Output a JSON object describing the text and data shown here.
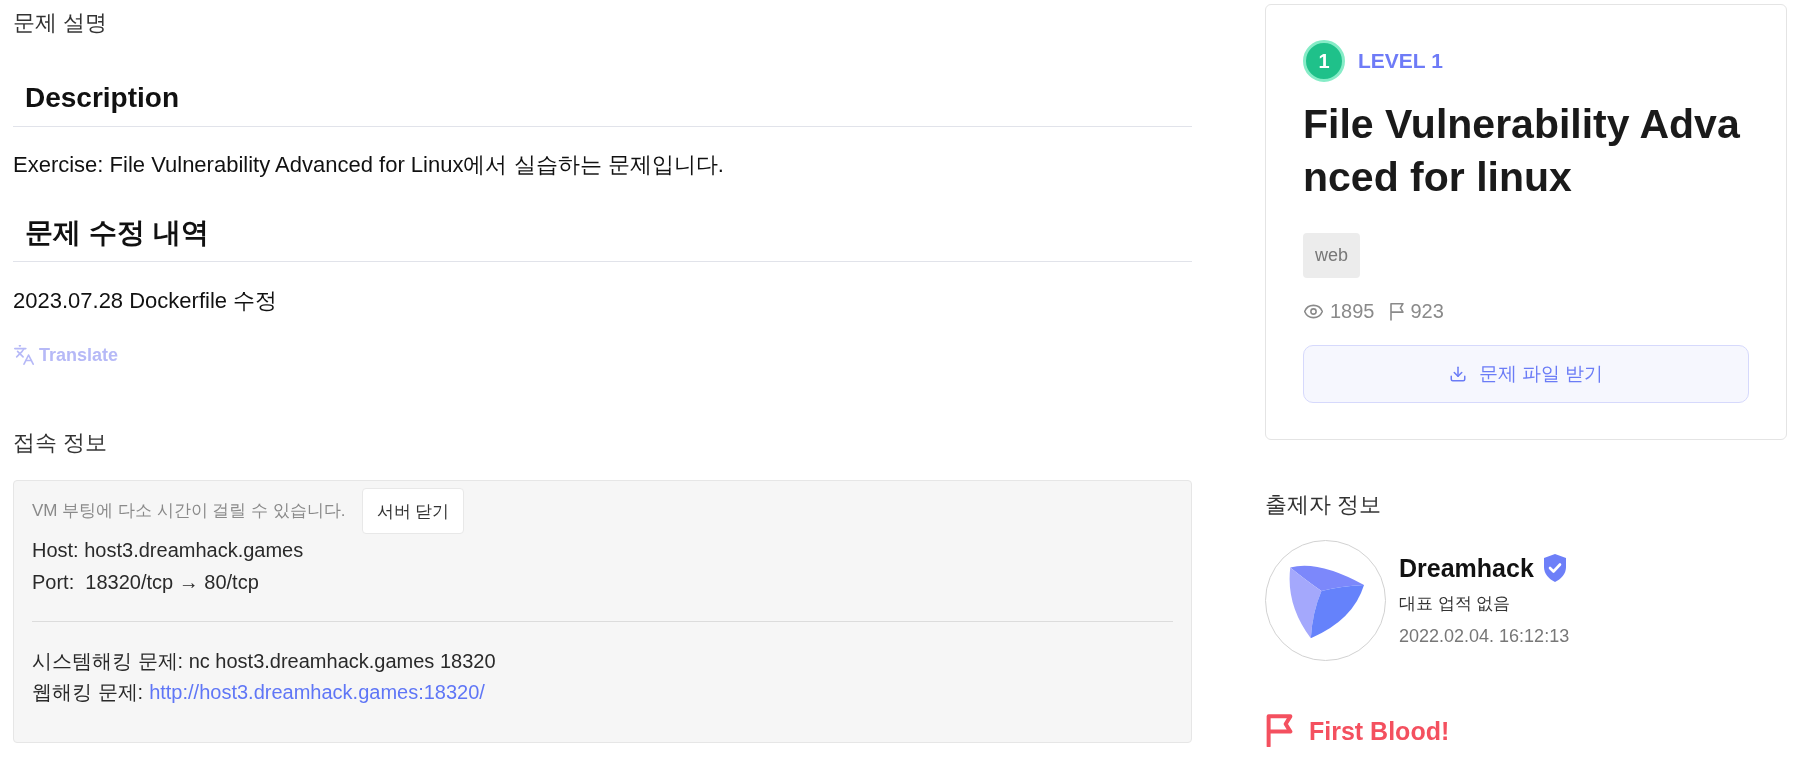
{
  "problem_description": {
    "title": "문제 설명",
    "sections": [
      {
        "heading": "Description",
        "body": "Exercise: File Vulnerability Advanced for Linux에서 실습하는 문제입니다."
      },
      {
        "heading": "문제 수정 내역",
        "body": "2023.07.28 Dockerfile 수정"
      }
    ],
    "translate_link": "Translate"
  },
  "connection_info": {
    "title": "접속 정보",
    "notice": "VM 부팅에 다소 시간이 걸릴 수 있습니다.",
    "close_button": "서버 닫기",
    "details": [
      "Host: host3.dreamhack.games",
      "Port:  18320/tcp → 80/tcp"
    ],
    "commands": [
      {
        "kind": "text",
        "text": "시스템해킹 문제: nc host3.dreamhack.games 18320"
      },
      {
        "kind": "link",
        "label": "웹해킹 문제:",
        "url": "http://host3.dreamhack.games:18320/"
      }
    ]
  },
  "challenge_card": {
    "level_number": "1",
    "level_label": "LEVEL 1",
    "title": "File Vulnerability Advanced for linux",
    "tags": [
      "web"
    ],
    "views": "1895",
    "solves": "923",
    "download_button": "문제 파일 받기"
  },
  "author": {
    "title": "출제자 정보",
    "name": "Dreamhack",
    "verified": true,
    "achievement": "대표 업적 없음",
    "date": "2022.02.04. 16:12:13"
  },
  "first_blood": {
    "title": "First Blood!"
  }
}
